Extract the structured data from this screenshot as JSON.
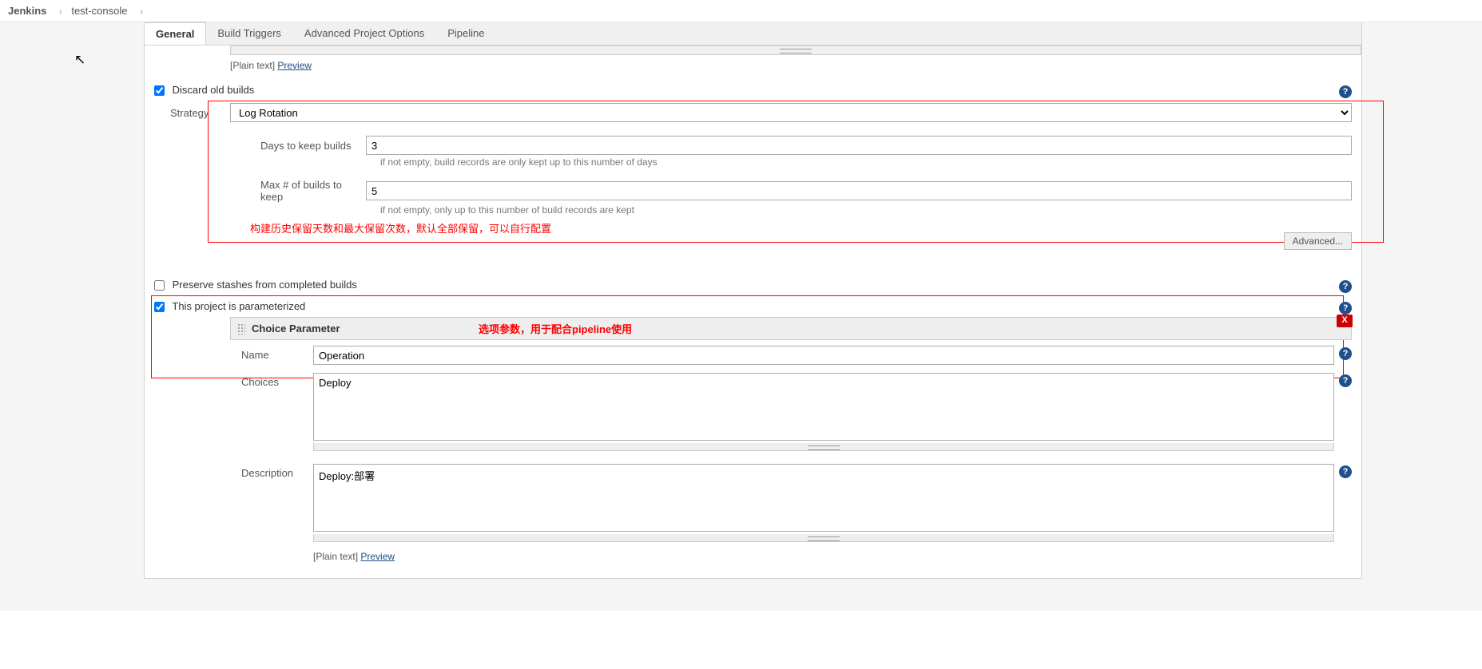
{
  "breadcrumb": {
    "root": "Jenkins",
    "project": "test-console"
  },
  "tabs": [
    "General",
    "Build Triggers",
    "Advanced Project Options",
    "Pipeline"
  ],
  "active_tab": "General",
  "preview_prefix": "[Plain text] ",
  "preview_link": "Preview",
  "discard_old_builds": {
    "label": "Discard old builds",
    "checked": true,
    "strategy_label": "Strategy",
    "strategy_value": "Log Rotation",
    "days_label": "Days to keep builds",
    "days_value": "3",
    "days_help": "if not empty, build records are only kept up to this number of days",
    "max_label": "Max # of builds to keep",
    "max_value": "5",
    "max_help": "if not empty, only up to this number of build records are kept",
    "advanced_btn": "Advanced...",
    "red_note": "构建历史保留天数和最大保留次数，默认全部保留，可以自行配置"
  },
  "preserve_stashes": {
    "label": "Preserve stashes from completed builds",
    "checked": false
  },
  "parameterized": {
    "label": "This project is parameterized",
    "checked": true
  },
  "choice_param": {
    "header": "Choice Parameter",
    "red_note": "选项参数，用于配合pipeline使用",
    "name_label": "Name",
    "name_value": "Operation",
    "choices_label": "Choices",
    "choices_value": "Deploy",
    "desc_label": "Description",
    "desc_value": "Deploy:部署"
  }
}
